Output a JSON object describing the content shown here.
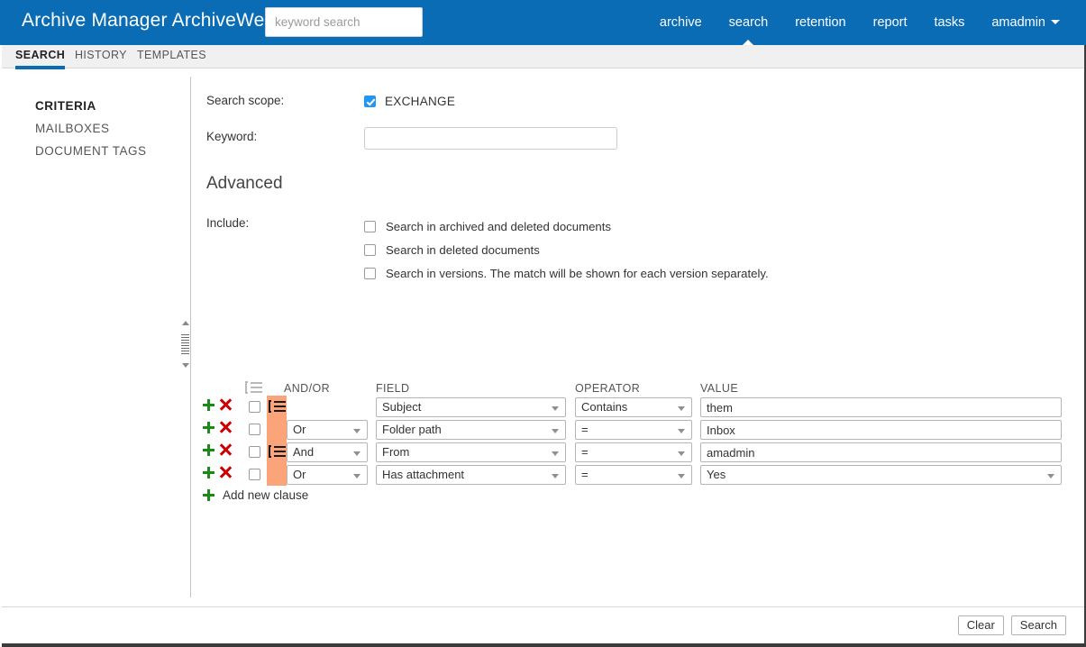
{
  "header": {
    "app_title": "Archive Manager ArchiveWeb",
    "search_placeholder": "keyword search",
    "search_value": "",
    "brand_color": "#0a6cb4",
    "nav": [
      {
        "label": "archive",
        "active": false
      },
      {
        "label": "search",
        "active": true
      },
      {
        "label": "retention",
        "active": false
      },
      {
        "label": "report",
        "active": false
      },
      {
        "label": "tasks",
        "active": false
      },
      {
        "label": "amadmin",
        "active": false,
        "has_caret": true
      }
    ]
  },
  "tabs": [
    {
      "label": "SEARCH",
      "active": true
    },
    {
      "label": "HISTORY",
      "active": false
    },
    {
      "label": "TEMPLATES",
      "active": false
    }
  ],
  "sidebar": {
    "items": [
      {
        "label": "CRITERIA",
        "active": true
      },
      {
        "label": "MAILBOXES",
        "active": false
      },
      {
        "label": "DOCUMENT TAGS",
        "active": false
      }
    ]
  },
  "form": {
    "scope_label": "Search scope:",
    "scope_option": "EXCHANGE",
    "scope_checked": true,
    "keyword_label": "Keyword:",
    "keyword_value": "",
    "advanced_title": "Advanced",
    "include_label": "Include:",
    "include_options": [
      {
        "label": "Search in archived and deleted documents",
        "checked": false
      },
      {
        "label": "Search in deleted documents",
        "checked": false
      },
      {
        "label": "Search in versions. The match will be shown for each version separately.",
        "checked": false
      }
    ]
  },
  "clauses": {
    "group_marker_color": "#fba379",
    "columns": {
      "andor": "AND/OR",
      "field": "FIELD",
      "operator": "OPERATOR",
      "value": "VALUE"
    },
    "rows": [
      {
        "andor": "",
        "show_andor": false,
        "group_icon": true,
        "field": "Subject",
        "operator": "Contains",
        "value": "them",
        "value_is_select": false,
        "checked": false
      },
      {
        "andor": "Or",
        "show_andor": true,
        "group_icon": false,
        "field": "Folder path",
        "operator": "=",
        "value": "Inbox",
        "value_is_select": false,
        "checked": false
      },
      {
        "andor": "And",
        "show_andor": true,
        "group_icon": true,
        "field": "From",
        "operator": "=",
        "value": "amadmin",
        "value_is_select": false,
        "checked": false
      },
      {
        "andor": "Or",
        "show_andor": true,
        "group_icon": false,
        "field": "Has attachment",
        "operator": "=",
        "value": "Yes",
        "value_is_select": true,
        "checked": false
      }
    ],
    "add_clause_label": "Add new clause"
  },
  "footer": {
    "clear_label": "Clear",
    "search_label": "Search"
  }
}
